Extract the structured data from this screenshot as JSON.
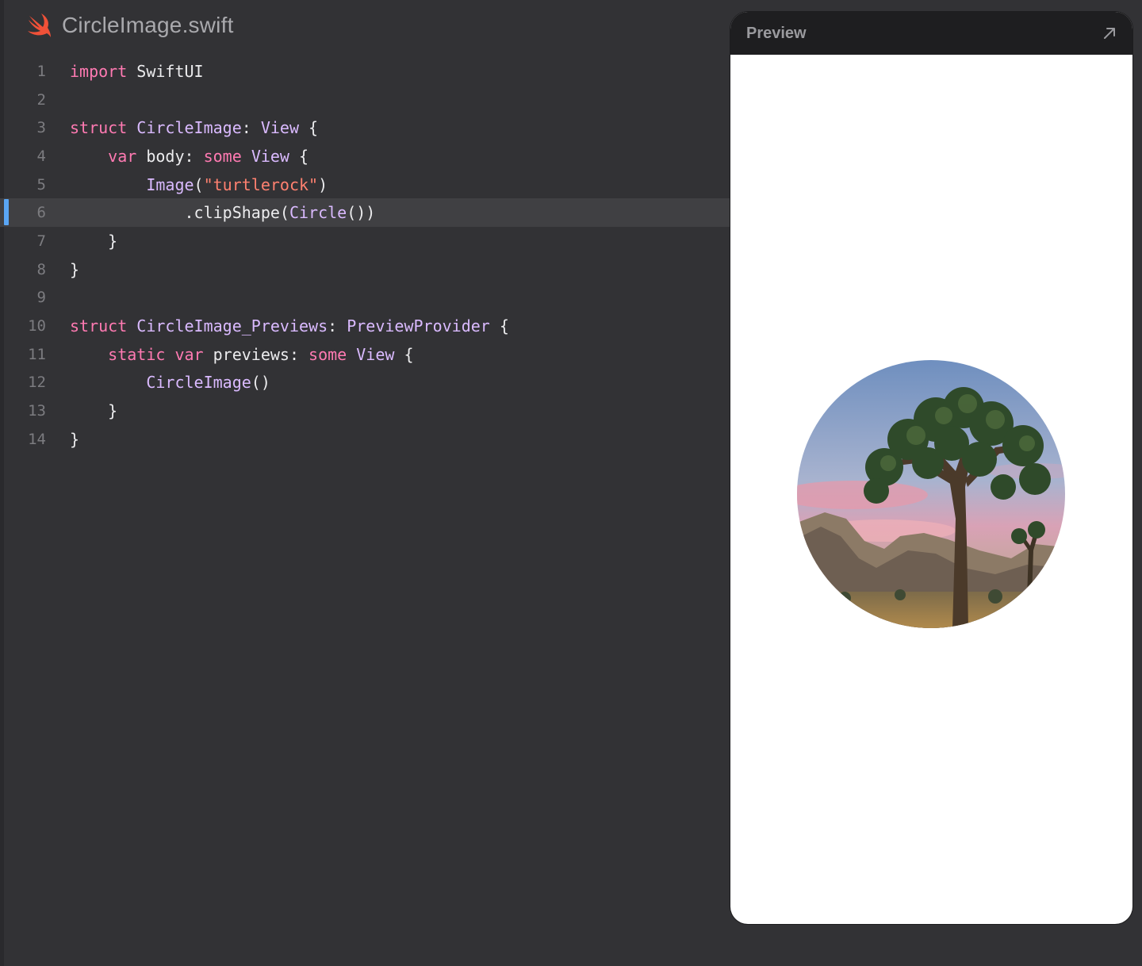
{
  "editor": {
    "file_name": "CircleImage.swift",
    "file_icon": "swift-icon",
    "active_line": 6,
    "lines": [
      {
        "num": "1"
      },
      {
        "num": "2"
      },
      {
        "num": "3"
      },
      {
        "num": "4"
      },
      {
        "num": "5"
      },
      {
        "num": "6"
      },
      {
        "num": "7"
      },
      {
        "num": "8"
      },
      {
        "num": "9"
      },
      {
        "num": "10"
      },
      {
        "num": "11"
      },
      {
        "num": "12"
      },
      {
        "num": "13"
      },
      {
        "num": "14"
      }
    ],
    "tokens": {
      "l1_a": "import",
      "l1_b": " SwiftUI",
      "l3_a": "struct",
      "l3_b": " ",
      "l3_c": "CircleImage",
      "l3_d": ": ",
      "l3_e": "View",
      "l3_f": " {",
      "l4_a": "    ",
      "l4_b": "var",
      "l4_c": " body: ",
      "l4_d": "some",
      "l4_e": " ",
      "l4_f": "View",
      "l4_g": " {",
      "l5_a": "        ",
      "l5_b": "Image",
      "l5_c": "(",
      "l5_d": "\"turtlerock\"",
      "l5_e": ")",
      "l6_a": "            .clipShape(",
      "l6_b": "Circle",
      "l6_c": "())",
      "l7_a": "    }",
      "l8_a": "}",
      "l10_a": "struct",
      "l10_b": " ",
      "l10_c": "CircleImage_Previews",
      "l10_d": ": ",
      "l10_e": "PreviewProvider",
      "l10_f": " {",
      "l11_a": "    ",
      "l11_b": "static",
      "l11_c": " ",
      "l11_d": "var",
      "l11_e": " previews: ",
      "l11_f": "some",
      "l11_g": " ",
      "l11_h": "View",
      "l11_i": " {",
      "l12_a": "        ",
      "l12_b": "CircleImage",
      "l12_c": "()",
      "l13_a": "    }",
      "l14_a": "}"
    }
  },
  "preview": {
    "title": "Preview",
    "expand_icon": "arrow-up-right-icon",
    "image_name": "turtlerock"
  },
  "colors": {
    "editor_background": "#323235",
    "keyword": "#ff7ab2",
    "type": "#dabaff",
    "string": "#ff8170",
    "plain": "#ececee",
    "line_number": "#7c7c80",
    "active_line_marker": "#5aa6f5",
    "swift_orange": "#f05138"
  }
}
